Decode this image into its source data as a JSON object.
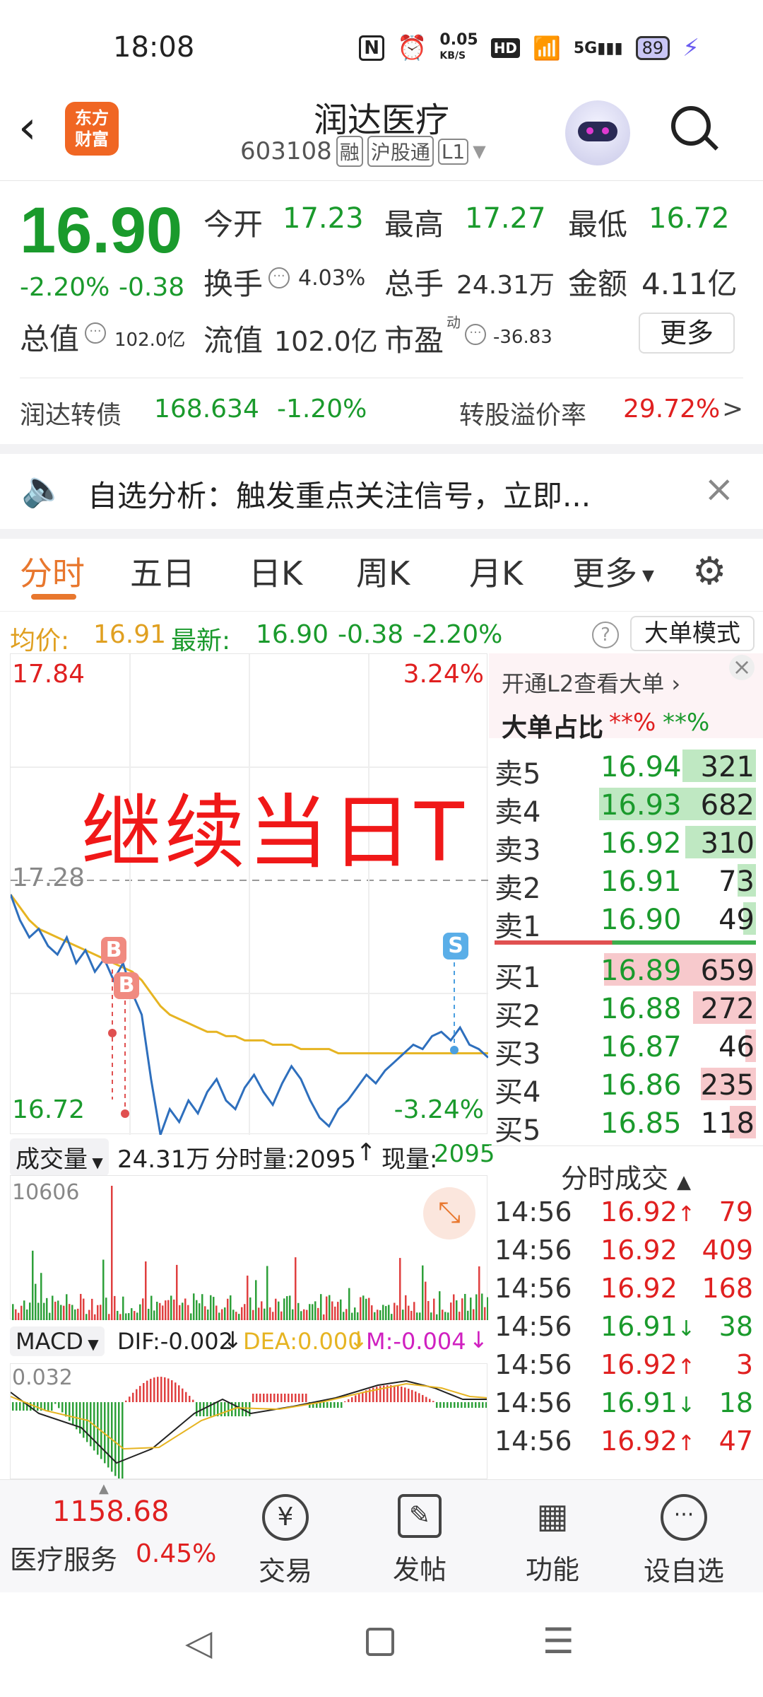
{
  "status_bar": {
    "time": "18:08",
    "speed": "0.05",
    "speed_unit": "KB/S",
    "hd": "HD",
    "net": "5G",
    "battery": "89"
  },
  "header": {
    "title": "润达医疗",
    "code": "603108",
    "tags": [
      "融",
      "沪股通",
      "L1"
    ],
    "logo": "东方\n财富"
  },
  "quote": {
    "price": "16.90",
    "change_pct": "-2.20%",
    "change": "-0.38",
    "open_label": "今开",
    "open": "17.23",
    "high_label": "最高",
    "high": "17.27",
    "low_label": "最低",
    "low": "16.72",
    "turnover_label": "换手",
    "turnover": "4.03%",
    "volume_label": "总手",
    "volume": "24.31万",
    "amount_label": "金额",
    "amount": "4.11亿",
    "mktcap_label": "总值",
    "mktcap": "102.0亿",
    "float_label": "流值",
    "float": "102.0亿",
    "pe_label": "市盈",
    "pe_sup": "动",
    "pe": "-36.83",
    "more_button": "更多"
  },
  "bond": {
    "name": "润达转债",
    "price": "168.634",
    "change": "-1.20%",
    "premium_label": "转股溢价率",
    "premium": "29.72%",
    "arrow": ">"
  },
  "notice": {
    "text": "自选分析：触发重点关注信号，立即..."
  },
  "tabs": [
    "分时",
    "五日",
    "日K",
    "周K",
    "月K",
    "更多"
  ],
  "avg_line": {
    "avg_label": "均价:",
    "avg": "16.91",
    "latest_label": "最新:",
    "latest": "16.90",
    "change": "-0.38",
    "pct": "-2.20%",
    "mode_button": "大单模式"
  },
  "chart": {
    "y_high": "17.84",
    "y_high_pct": "3.24%",
    "y_mid": "17.28",
    "y_low": "16.72",
    "y_low_pct": "-3.24%",
    "overlay_text": "继续当日T",
    "markers": [
      "B",
      "B",
      "S"
    ]
  },
  "chart_data": {
    "type": "line",
    "series": [
      {
        "name": "",
        "values": [
          17.28,
          17.22,
          17.18,
          17.2,
          17.16,
          17.14,
          17.18,
          17.12,
          17.15,
          17.1,
          17.13,
          17.08,
          17.12,
          17.05,
          17.0,
          16.85,
          16.72,
          16.78,
          16.75,
          16.8,
          16.77,
          16.82,
          16.85,
          16.8,
          16.78,
          16.83,
          16.86,
          16.82,
          16.79,
          16.84,
          16.88,
          16.85,
          16.8,
          16.76,
          16.74,
          16.78,
          16.8,
          16.83,
          16.86,
          16.84,
          16.87,
          16.89,
          16.91,
          16.93,
          16.92,
          16.95,
          16.96,
          16.94,
          16.97,
          16.93,
          16.92,
          16.9
        ]
      },
      {
        "name": "",
        "values": [
          17.28,
          17.25,
          17.22,
          17.2,
          17.19,
          17.18,
          17.17,
          17.16,
          17.15,
          17.14,
          17.13,
          17.12,
          17.11,
          17.1,
          17.08,
          17.05,
          17.02,
          17.0,
          16.99,
          16.98,
          16.97,
          16.96,
          16.96,
          16.95,
          16.95,
          16.94,
          16.94,
          16.94,
          16.93,
          16.93,
          16.93,
          16.92,
          16.92,
          16.92,
          16.92,
          16.91,
          16.91,
          16.91,
          16.91,
          16.91,
          16.91,
          16.91,
          16.91,
          16.91,
          16.91,
          16.91,
          16.91,
          16.91,
          16.91,
          16.91,
          16.91,
          16.91
        ]
      }
    ],
    "ylim": [
      16.72,
      17.84
    ]
  },
  "volume": {
    "label": "成交量",
    "total": "24.31万",
    "tick_label": "分时量:2095",
    "now_label": "现量:",
    "now": "2095",
    "max": "10606"
  },
  "macd": {
    "label": "MACD",
    "dif": "DIF:-0.002",
    "dea": "DEA:0.000",
    "m": "M:-0.004",
    "scale": "0.032"
  },
  "l2": {
    "promo": "开通L2查看大单",
    "ratio_label": "大单占比",
    "ratio_sell": "**%",
    "ratio_buy": "**%"
  },
  "asks": [
    {
      "label": "卖5",
      "price": "16.94",
      "vol": "321",
      "pct": 0.28
    },
    {
      "label": "卖4",
      "price": "16.93",
      "vol": "682",
      "pct": 0.6
    },
    {
      "label": "卖3",
      "price": "16.92",
      "vol": "310",
      "pct": 0.27
    },
    {
      "label": "卖2",
      "price": "16.91",
      "vol": "73",
      "pct": 0.07
    },
    {
      "label": "卖1",
      "price": "16.90",
      "vol": "49",
      "pct": 0.05
    }
  ],
  "bids": [
    {
      "label": "买1",
      "price": "16.89",
      "vol": "659",
      "pct": 0.58
    },
    {
      "label": "买2",
      "price": "16.88",
      "vol": "272",
      "pct": 0.24
    },
    {
      "label": "买3",
      "price": "16.87",
      "vol": "46",
      "pct": 0.04
    },
    {
      "label": "买4",
      "price": "16.86",
      "vol": "235",
      "pct": 0.21
    },
    {
      "label": "买5",
      "price": "16.85",
      "vol": "118",
      "pct": 0.1
    }
  ],
  "ticks_header": "分时成交",
  "ticks": [
    {
      "time": "14:56",
      "price": "16.92",
      "dir": "↑",
      "vol": "79",
      "color": "red"
    },
    {
      "time": "14:56",
      "price": "16.92",
      "dir": "",
      "vol": "409",
      "color": "red"
    },
    {
      "time": "14:56",
      "price": "16.92",
      "dir": "",
      "vol": "168",
      "color": "red"
    },
    {
      "time": "14:56",
      "price": "16.91",
      "dir": "↓",
      "vol": "38",
      "color": "green"
    },
    {
      "time": "14:56",
      "price": "16.92",
      "dir": "↑",
      "vol": "3",
      "color": "red"
    },
    {
      "time": "14:56",
      "price": "16.91",
      "dir": "↓",
      "vol": "18",
      "color": "green"
    },
    {
      "time": "14:56",
      "price": "16.92",
      "dir": "↑",
      "vol": "47",
      "color": "red"
    }
  ],
  "bottom_nav": {
    "index_value": "1158.68",
    "index_name": "医疗服务",
    "index_pct": "0.45%",
    "items": [
      "交易",
      "发帖",
      "功能",
      "设自选"
    ]
  }
}
